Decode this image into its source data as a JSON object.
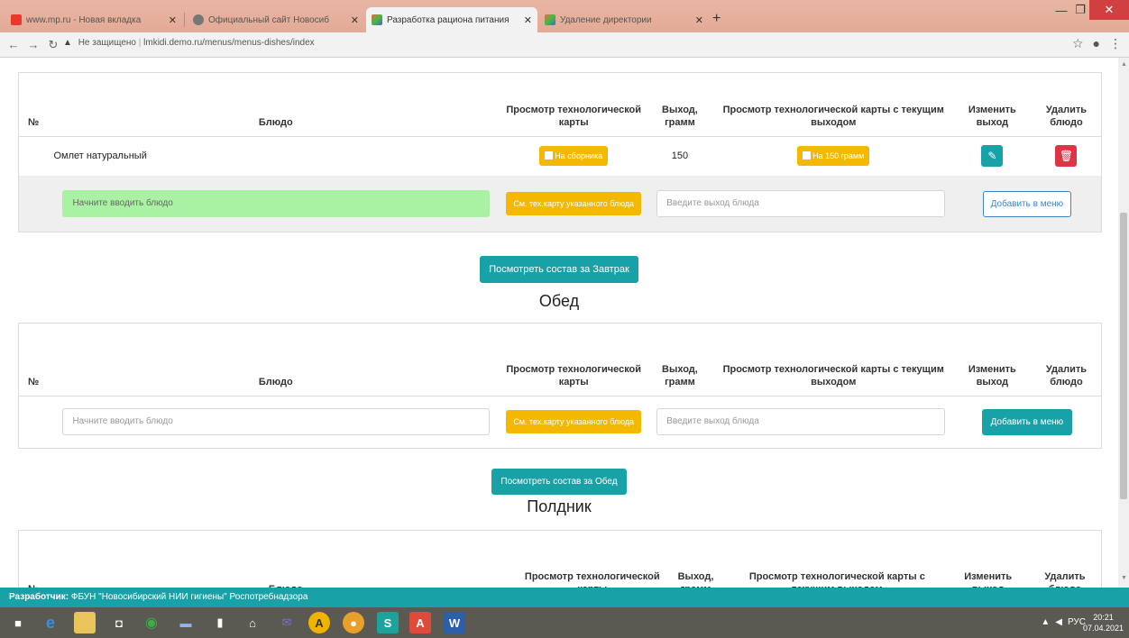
{
  "browser": {
    "tabs": [
      {
        "title": "www.mp.ru - Новая вкладка"
      },
      {
        "title": "Официальный сайт Новосиб"
      },
      {
        "title": "Разработка рациона питания"
      },
      {
        "title": "Удаление директории"
      }
    ],
    "url_warning": "Не защищено",
    "url": "lmkidi.demo.ru/menus/menus-dishes/index"
  },
  "breakfast": {
    "headers": {
      "num": "№",
      "dish": "Блюдо",
      "view_card": "Просмотр технологической карты",
      "yield": "Выход, грамм",
      "view_card_yield": "Просмотр технологической карты с текущим выходом",
      "change_yield": "Изменить выход",
      "delete": "Удалить блюдо"
    },
    "rows": [
      {
        "dish": "Омлет натуральный",
        "card_btn": "На сборника",
        "yield": "150",
        "yield_btn": "На 150 грамм"
      }
    ],
    "add": {
      "dish_placeholder": "Начните вводить блюдо",
      "card_btn": "См. тех.карту указанного блюда",
      "yield_placeholder": "Введите выход блюда",
      "add_btn": "Добавить в меню"
    },
    "view_btn": "Посмотреть состав за Завтрак"
  },
  "lunch": {
    "title": "Обед",
    "headers": {
      "num": "№",
      "dish": "Блюдо",
      "view_card": "Просмотр технологической карты",
      "yield": "Выход, грамм",
      "view_card_yield": "Просмотр технологической карты с текущим выходом",
      "change_yield": "Изменить выход",
      "delete": "Удалить блюдо"
    },
    "add": {
      "dish_placeholder": "Начните вводить блюдо",
      "card_btn": "См. тех.карту указанного блюда",
      "yield_placeholder": "Введите выход блюда",
      "add_btn": "Добавить в меню"
    },
    "view_btn": "Посмотреть состав за Обед"
  },
  "snack": {
    "title": "Полдник",
    "headers": {
      "num": "№",
      "dish": "Блюдо",
      "view_card": "Просмотр технологической карты",
      "yield": "Выход, грамм",
      "view_card_yield": "Просмотр технологической карты с текущим выходом",
      "change_yield": "Изменить выход",
      "delete": "Удалить блюдо"
    }
  },
  "footer": {
    "label": "Разработчик:",
    "text": "ФБУН \"Новосибирский НИИ гигиены\" Роспотребнадзора"
  },
  "taskbar": {
    "tray": "РУС",
    "time": "20:21",
    "date": "07.04.2021"
  },
  "colors": {
    "teal": "#18a2a8",
    "orange": "#f5b800",
    "red": "#dc3545",
    "green_input": "#a9f2a4"
  }
}
